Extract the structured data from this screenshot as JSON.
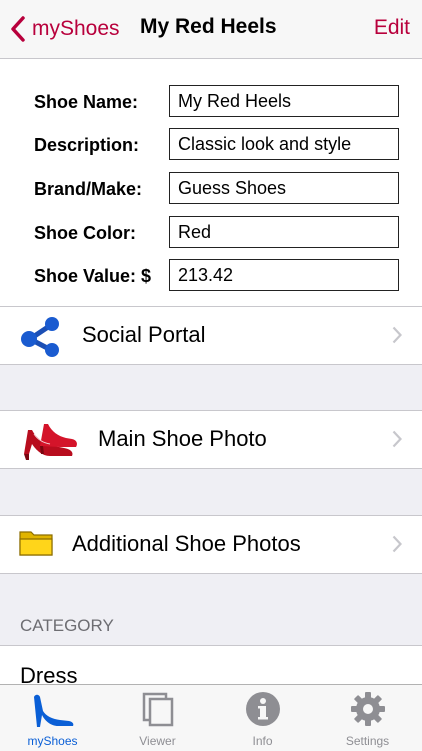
{
  "nav": {
    "back_label": "myShoes",
    "title": "My Red Heels",
    "edit_label": "Edit"
  },
  "form": {
    "fields": [
      {
        "label": "Shoe Name:",
        "value": "My Red Heels"
      },
      {
        "label": "Description:",
        "value": "Classic look and style"
      },
      {
        "label": "Brand/Make:",
        "value": "Guess Shoes"
      },
      {
        "label": "Shoe Color:",
        "value": "Red"
      },
      {
        "label": "Shoe Value: $",
        "value": "213.42"
      }
    ]
  },
  "cells": {
    "social": {
      "label": "Social Portal",
      "icon": "share-icon"
    },
    "main_photo": {
      "label": "Main Shoe Photo",
      "icon": "red-heels-icon"
    },
    "additional_photos": {
      "label": "Additional Shoe Photos",
      "icon": "folder-icon"
    }
  },
  "category": {
    "header": "CATEGORY",
    "value": "Dress"
  },
  "tabs": [
    {
      "label": "myShoes",
      "icon": "high-heel-icon",
      "active": true
    },
    {
      "label": "Viewer",
      "icon": "stacked-pages-icon",
      "active": false
    },
    {
      "label": "Info",
      "icon": "info-icon",
      "active": false
    },
    {
      "label": "Settings",
      "icon": "gear-icon",
      "active": false
    }
  ],
  "colors": {
    "accent": "#b8003c",
    "tab_active": "#0a5fd6"
  }
}
